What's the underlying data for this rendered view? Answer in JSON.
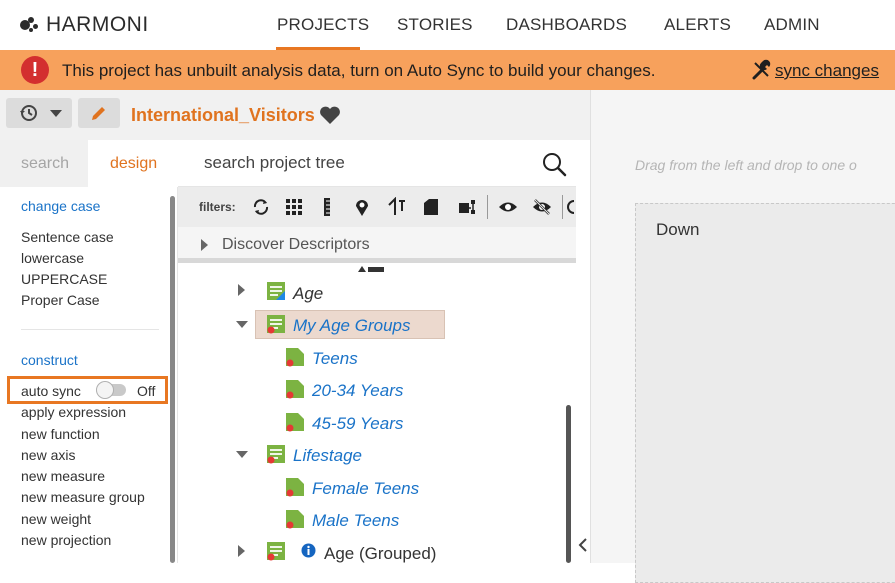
{
  "nav": {
    "logo": "HARMONI",
    "items": [
      "PROJECTS",
      "STORIES",
      "DASHBOARDS",
      "ALERTS",
      "ADMIN"
    ],
    "active": "PROJECTS"
  },
  "banner": {
    "icon": "!",
    "message": "This project has unbuilt analysis data, turn on Auto Sync to build your changes.",
    "link": "sync changes",
    "color": "#f7a15c"
  },
  "project": {
    "title": "International_Visitors"
  },
  "sidebar": {
    "tabs": [
      "search",
      "design"
    ],
    "active_tab": "design",
    "change_case": {
      "heading": "change case",
      "items": [
        "Sentence case",
        "lowercase",
        "UPPERCASE",
        "Proper Case"
      ]
    },
    "construct": {
      "heading": "construct",
      "auto_sync_label": "auto sync",
      "auto_sync_state": "Off",
      "items": [
        "apply expression",
        "new function",
        "new axis",
        "new measure",
        "new measure group",
        "new weight",
        "new projection"
      ]
    }
  },
  "tree": {
    "search_placeholder": "search project tree",
    "filters_label": "filters:",
    "discover_label": "Discover Descriptors",
    "nodes": [
      {
        "label": "Age"
      },
      {
        "label": "My Age Groups"
      },
      {
        "label": "Teens"
      },
      {
        "label": "20-34 Years"
      },
      {
        "label": "45-59 Years"
      },
      {
        "label": "Lifestage"
      },
      {
        "label": "Female Teens"
      },
      {
        "label": "Male Teens"
      },
      {
        "label": "Age (Grouped)"
      }
    ]
  },
  "canvas": {
    "hint": "Drag from the left and drop to one o",
    "drop_label": "Down"
  },
  "colors": {
    "accent": "#e87722",
    "link": "#1a73c8",
    "title": "#e0731f"
  }
}
